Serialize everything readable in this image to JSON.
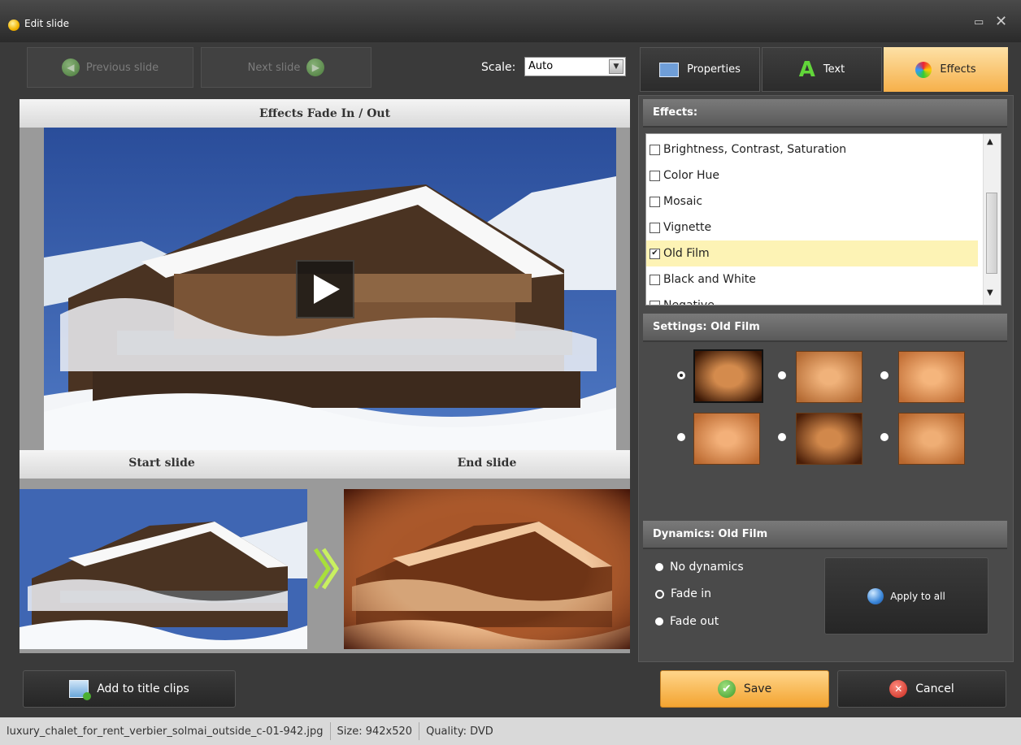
{
  "window": {
    "title": "Edit slide"
  },
  "nav": {
    "previous_label": "Previous slide",
    "next_label": "Next slide",
    "scale_label": "Scale:",
    "scale_value": "Auto"
  },
  "preview": {
    "header": "Effects Fade In / Out",
    "start_label": "Start slide",
    "end_label": "End slide"
  },
  "tabs": [
    {
      "label": "Properties",
      "icon": "properties-icon",
      "active": false
    },
    {
      "label": "Text",
      "icon": "text-a-icon",
      "active": false
    },
    {
      "label": "Effects",
      "icon": "palette-icon",
      "active": true
    }
  ],
  "effects": {
    "header": "Effects:",
    "items": [
      {
        "label": "Brightness, Contrast, Saturation",
        "checked": false
      },
      {
        "label": "Color Hue",
        "checked": false
      },
      {
        "label": "Mosaic",
        "checked": false
      },
      {
        "label": "Vignette",
        "checked": false
      },
      {
        "label": "Old Film",
        "checked": true,
        "selected": true
      },
      {
        "label": "Black and White",
        "checked": false
      },
      {
        "label": "Negative",
        "checked": false
      }
    ]
  },
  "settings": {
    "header": "Settings: Old Film",
    "selected_preset": 1,
    "preset_count": 6
  },
  "dynamics": {
    "header": "Dynamics: Old Film",
    "options": [
      {
        "label": "No dynamics",
        "selected": false
      },
      {
        "label": "Fade in",
        "selected": true
      },
      {
        "label": "Fade out",
        "selected": false
      }
    ],
    "apply_label": "Apply to all"
  },
  "buttons": {
    "add_title_clips": "Add to title clips",
    "save": "Save",
    "cancel": "Cancel"
  },
  "status": {
    "filename": "luxury_chalet_for_rent_verbier_solmai_outside_c-01-942.jpg",
    "size": "Size: 942x520",
    "quality": "Quality: DVD"
  },
  "colors": {
    "accent_orange": "#f6b04a",
    "save_green": "#4caf32",
    "cancel_red": "#d9352a",
    "selection_yellow": "#fdf3b5"
  }
}
